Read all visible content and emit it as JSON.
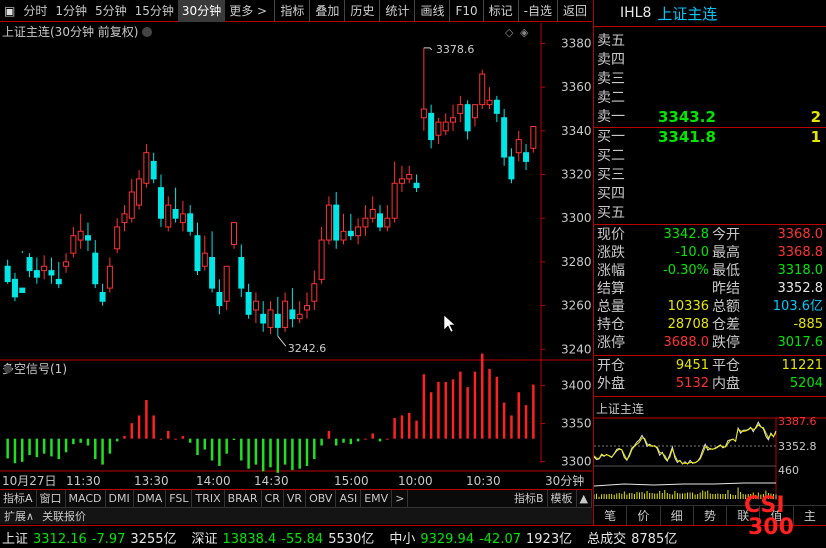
{
  "toolbar": {
    "periods": [
      "分时",
      "1分钟",
      "5分钟",
      "15分钟",
      "30分钟",
      "更多 >"
    ],
    "active_period": "30分钟",
    "buttons": [
      "指标",
      "叠加",
      "历史",
      "统计",
      "画线",
      "F10",
      "标记",
      "-自选",
      "返回"
    ]
  },
  "chart": {
    "title": "上证主连(30分钟 前复权)",
    "y_ticks": [
      "3380",
      "3360",
      "3340",
      "3320",
      "3300",
      "3280",
      "3260",
      "3240"
    ],
    "high_label": "3378.6",
    "low_label": "3242.6",
    "indicator_title": "多空信号(1)",
    "ind_ticks": [
      "3400",
      "3350",
      "3300"
    ],
    "x_labels": [
      "10月27日",
      "11:30",
      "13:30",
      "14:00",
      "14:30",
      "15:00",
      "10:00",
      "10:30"
    ],
    "period_label": "30分钟"
  },
  "chart_data": {
    "type": "candlestick",
    "ylim": [
      3236,
      3388
    ],
    "candles": [
      [
        3278,
        3281,
        3271,
        3270
      ],
      [
        3272,
        3275,
        3264,
        3262
      ],
      [
        3268,
        3284,
        3266,
        3285
      ],
      [
        3282,
        3284,
        3276,
        3273
      ],
      [
        3276,
        3282,
        3273,
        3270
      ],
      [
        3276,
        3283,
        3278,
        3272
      ],
      [
        3276,
        3282,
        3274,
        3270
      ],
      [
        3272,
        3280,
        3270,
        3268
      ],
      [
        3278,
        3284,
        3280,
        3275
      ],
      [
        3284,
        3296,
        3292,
        3282
      ],
      [
        3290,
        3302,
        3294,
        3286
      ],
      [
        3292,
        3298,
        3290,
        3285
      ],
      [
        3284,
        3290,
        3270,
        3268
      ],
      [
        3266,
        3270,
        3262,
        3260
      ],
      [
        3268,
        3282,
        3278,
        3266
      ],
      [
        3286,
        3300,
        3296,
        3284
      ],
      [
        3298,
        3306,
        3302,
        3294
      ],
      [
        3300,
        3318,
        3312,
        3298
      ],
      [
        3306,
        3322,
        3318,
        3304
      ],
      [
        3316,
        3334,
        3330,
        3314
      ],
      [
        3326,
        3330,
        3318,
        3316
      ],
      [
        3314,
        3320,
        3300,
        3296
      ],
      [
        3296,
        3310,
        3306,
        3294
      ],
      [
        3304,
        3314,
        3300,
        3298
      ],
      [
        3298,
        3308,
        3302,
        3294
      ],
      [
        3302,
        3306,
        3294,
        3292
      ],
      [
        3292,
        3298,
        3276,
        3274
      ],
      [
        3278,
        3292,
        3284,
        3276
      ],
      [
        3282,
        3294,
        3268,
        3266
      ],
      [
        3266,
        3272,
        3260,
        3256
      ],
      [
        3262,
        3270,
        3278,
        3258
      ],
      [
        3288,
        3296,
        3298,
        3286
      ],
      [
        3282,
        3288,
        3268,
        3264
      ],
      [
        3266,
        3270,
        3256,
        3254
      ],
      [
        3258,
        3266,
        3262,
        3252
      ],
      [
        3256,
        3262,
        3252,
        3248
      ],
      [
        3250,
        3262,
        3258,
        3247
      ],
      [
        3256,
        3264,
        3250,
        3246
      ],
      [
        3250,
        3266,
        3262,
        3248
      ],
      [
        3258,
        3268,
        3254,
        3250
      ],
      [
        3254,
        3262,
        3256,
        3252
      ],
      [
        3258,
        3266,
        3260,
        3254
      ],
      [
        3262,
        3276,
        3270,
        3258
      ],
      [
        3272,
        3296,
        3290,
        3270
      ],
      [
        3290,
        3310,
        3306,
        3288
      ],
      [
        3306,
        3312,
        3290,
        3286
      ],
      [
        3290,
        3302,
        3294,
        3288
      ],
      [
        3294,
        3302,
        3292,
        3290
      ],
      [
        3292,
        3300,
        3296,
        3288
      ],
      [
        3296,
        3306,
        3300,
        3292
      ],
      [
        3300,
        3310,
        3304,
        3298
      ],
      [
        3302,
        3306,
        3296,
        3294
      ],
      [
        3296,
        3306,
        3300,
        3294
      ],
      [
        3300,
        3326,
        3316,
        3298
      ],
      [
        3316,
        3324,
        3318,
        3312
      ],
      [
        3318,
        3324,
        3320,
        3316
      ],
      [
        3316,
        3320,
        3314,
        3312
      ],
      [
        3346,
        3378,
        3350,
        3340
      ],
      [
        3348,
        3352,
        3336,
        3332
      ],
      [
        3338,
        3346,
        3344,
        3334
      ],
      [
        3340,
        3348,
        3344,
        3338
      ],
      [
        3344,
        3352,
        3346,
        3340
      ],
      [
        3348,
        3356,
        3352,
        3344
      ],
      [
        3352,
        3354,
        3340,
        3336
      ],
      [
        3346,
        3350,
        3352,
        3342
      ],
      [
        3352,
        3368,
        3366,
        3350
      ],
      [
        3352,
        3360,
        3354,
        3350
      ],
      [
        3354,
        3356,
        3348,
        3344
      ],
      [
        3346,
        3350,
        3328,
        3324
      ],
      [
        3328,
        3332,
        3318,
        3316
      ],
      [
        3330,
        3340,
        3336,
        3326
      ],
      [
        3330,
        3334,
        3326,
        3322
      ],
      [
        3332,
        3340,
        3342,
        3330
      ]
    ]
  },
  "quote": {
    "symbol": "IHL8",
    "name": "上证主连",
    "asks": [
      {
        "label": "卖五",
        "price": "",
        "qty": ""
      },
      {
        "label": "卖四",
        "price": "",
        "qty": ""
      },
      {
        "label": "卖三",
        "price": "",
        "qty": ""
      },
      {
        "label": "卖二",
        "price": "",
        "qty": ""
      },
      {
        "label": "卖一",
        "price": "3343.2",
        "qty": "2"
      }
    ],
    "bids": [
      {
        "label": "买一",
        "price": "3341.8",
        "qty": "1"
      },
      {
        "label": "买二",
        "price": "",
        "qty": ""
      },
      {
        "label": "买三",
        "price": "",
        "qty": ""
      },
      {
        "label": "买四",
        "price": "",
        "qty": ""
      },
      {
        "label": "买五",
        "price": "",
        "qty": ""
      }
    ],
    "stats": [
      {
        "l1": "现价",
        "v1": "3342.8",
        "c1": "green",
        "l2": "今开",
        "v2": "3368.0",
        "c2": "red"
      },
      {
        "l1": "涨跌",
        "v1": "-10.0",
        "c1": "green",
        "l2": "最高",
        "v2": "3368.8",
        "c2": "red"
      },
      {
        "l1": "涨幅",
        "v1": "-0.30%",
        "c1": "green",
        "l2": "最低",
        "v2": "3318.0",
        "c2": "green"
      },
      {
        "l1": "结算",
        "v1": "",
        "c1": "white",
        "l2": "昨结",
        "v2": "3352.8",
        "c2": "white"
      },
      {
        "l1": "总量",
        "v1": "10336",
        "c1": "yellow",
        "l2": "总额",
        "v2": "103.6亿",
        "c2": "cyan"
      },
      {
        "l1": "持仓",
        "v1": "28708",
        "c1": "yellow",
        "l2": "仓差",
        "v2": "-885",
        "c2": "yellow"
      },
      {
        "l1": "涨停",
        "v1": "3688.0",
        "c1": "red",
        "l2": "跌停",
        "v2": "3017.6",
        "c2": "green"
      }
    ],
    "stats2": [
      {
        "l1": "开仓",
        "v1": "9451",
        "c1": "yellow",
        "l2": "平仓",
        "v2": "11221",
        "c2": "yellow"
      },
      {
        "l1": "外盘",
        "v1": "5132",
        "c1": "red",
        "l2": "内盘",
        "v2": "5204",
        "c2": "green"
      }
    ],
    "mini_title": "上证主连",
    "mini_ticks": [
      "3387.6",
      "3352.8",
      "460"
    ]
  },
  "footer": {
    "indicators": [
      "指标A",
      "窗口",
      "MACD",
      "DMI",
      "DMA",
      "FSL",
      "TRIX",
      "BRAR",
      "CR",
      "VR",
      "OBV",
      "ASI",
      "EMV",
      ">"
    ],
    "right": [
      "指标B",
      "模板",
      "▲"
    ],
    "tabs2": [
      "扩展∧",
      "关联报价"
    ],
    "rtabs": [
      "笔",
      "价",
      "细",
      "势",
      "联",
      "值",
      "主"
    ]
  },
  "status": {
    "items": [
      {
        "name": "上证",
        "value": "3312.16",
        "chg": "-7.97",
        "amt": "3255亿"
      },
      {
        "name": "深证",
        "value": "13838.4",
        "chg": "-55.84",
        "amt": "5530亿"
      },
      {
        "name": "中小",
        "value": "9329.94",
        "chg": "-42.07",
        "amt": "1923亿"
      }
    ],
    "total_label": "总成交",
    "total_value": "8785亿"
  },
  "logo": {
    "line1": "CSI",
    "line2": "300"
  }
}
